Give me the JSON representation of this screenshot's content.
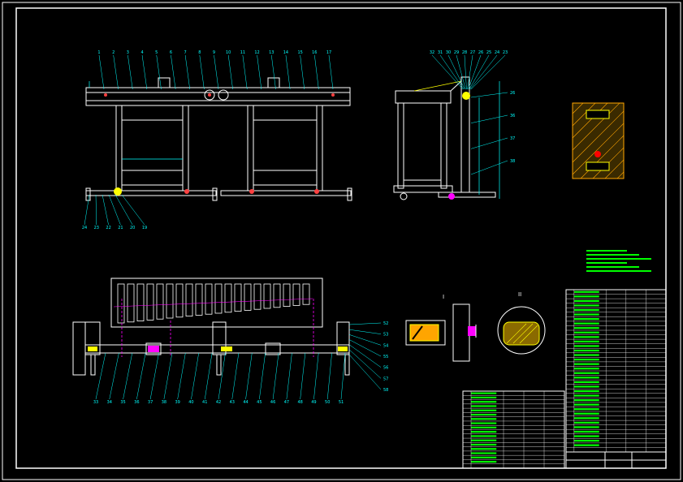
{
  "drawing": {
    "title_block": {
      "name": "",
      "code": "",
      "material": "",
      "scale": "",
      "sheet": ""
    },
    "section_labels": {
      "detail_left": "I",
      "detail_right": "II"
    },
    "front_view_balloons_top": [
      "1",
      "2",
      "3",
      "4",
      "5",
      "6",
      "7",
      "8",
      "9",
      "10",
      "11",
      "12",
      "13",
      "14",
      "15",
      "16",
      "17"
    ],
    "front_view_balloons_bottom": [
      "24",
      "23",
      "22",
      "21",
      "20",
      "19"
    ],
    "side_view_balloons_top": [
      "32",
      "31",
      "30",
      "29",
      "28",
      "27",
      "26",
      "25",
      "24",
      "23"
    ],
    "side_view_balloons_right": [
      "26",
      "36",
      "37",
      "38"
    ],
    "plan_view_balloons_bottom": [
      "33",
      "34",
      "35",
      "36",
      "37",
      "38",
      "39",
      "40",
      "41",
      "42",
      "43",
      "44",
      "45",
      "46",
      "47",
      "48",
      "49",
      "50",
      "51"
    ],
    "plan_view_balloons_right": [
      "52",
      "53",
      "54",
      "55",
      "56",
      "57",
      "58"
    ],
    "tech_notes_heading": "",
    "tech_notes": [
      "",
      "",
      "",
      "",
      "",
      ""
    ]
  },
  "colors": {
    "background": "#000000",
    "frame": "#ffffff",
    "balloon": "#00ffff",
    "dimension": "#00ffff",
    "centerline": "#ff00ff",
    "text": "#00ff00",
    "part": "#ffffff",
    "accent": "#ffff00",
    "hatch": "#ffa500"
  }
}
